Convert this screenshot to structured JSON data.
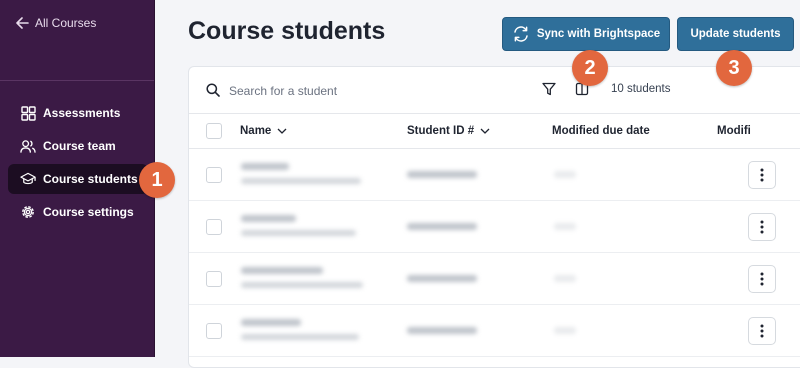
{
  "sidebar": {
    "back_label": "All Courses",
    "items": [
      {
        "label": "Assessments",
        "icon": "grid-icon"
      },
      {
        "label": "Course team",
        "icon": "people-icon"
      },
      {
        "label": "Course students",
        "icon": "graduation-cap-icon",
        "active": true
      },
      {
        "label": "Course settings",
        "icon": "gear-icon"
      }
    ]
  },
  "header": {
    "title": "Course students",
    "sync_label": "Sync with Brightspace",
    "update_label": "Update students"
  },
  "toolbar": {
    "search_placeholder": "Search for a student",
    "student_count": "10 students"
  },
  "table": {
    "columns": [
      "Name",
      "Student ID #",
      "Modified due date",
      "Modifi"
    ],
    "row_count_visible": 4
  },
  "badges": [
    "1",
    "2",
    "3"
  ],
  "colors": {
    "sidebar_bg": "#3b1a45",
    "active_item_bg": "#1c0d22",
    "button_bg": "#2f6f9a",
    "badge_bg": "#e2673e",
    "page_bg": "#f4f5f8"
  }
}
